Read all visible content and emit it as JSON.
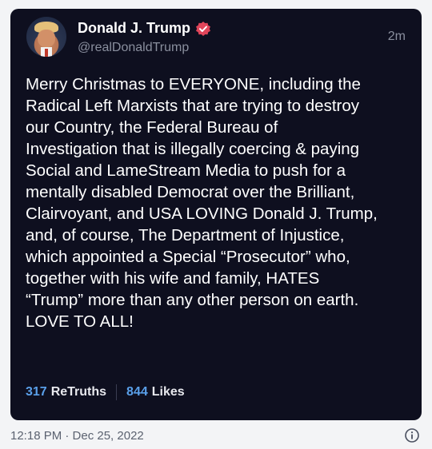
{
  "post": {
    "author_name": "Donald J. Trump",
    "author_handle": "@realDonaldTrump",
    "time_ago": "2m",
    "text_lines": [
      "Merry Christmas to EVERYONE, including the",
      "Radical Left Marxists that are trying to destroy",
      "our Country, the Federal Bureau of",
      "Investigation that is illegally coercing & paying",
      "Social and LameStream Media to push for a",
      "mentally disabled Democrat over the Brilliant,",
      "Clairvoyant, and USA LOVING Donald J. Trump,",
      "and, of course, The Department of Injustice,",
      "which appointed a Special “Prosecutor” who,",
      "together with his wife and family, HATES",
      "“Trump” more than any other person on earth.",
      "LOVE TO ALL!"
    ],
    "retruths_count": "317",
    "retruths_label": "ReTruths",
    "likes_count": "844",
    "likes_label": "Likes"
  },
  "footer": {
    "timestamp": "12:18 PM · Dec 25, 2022"
  },
  "icons": {
    "verified": "verified-badge-icon",
    "info": "info-icon"
  },
  "colors": {
    "card_background": "#0e0f1f",
    "page_background": "#f3f4f6",
    "accent_count": "#5aa0ea",
    "verified_badge": "#e0455a"
  }
}
